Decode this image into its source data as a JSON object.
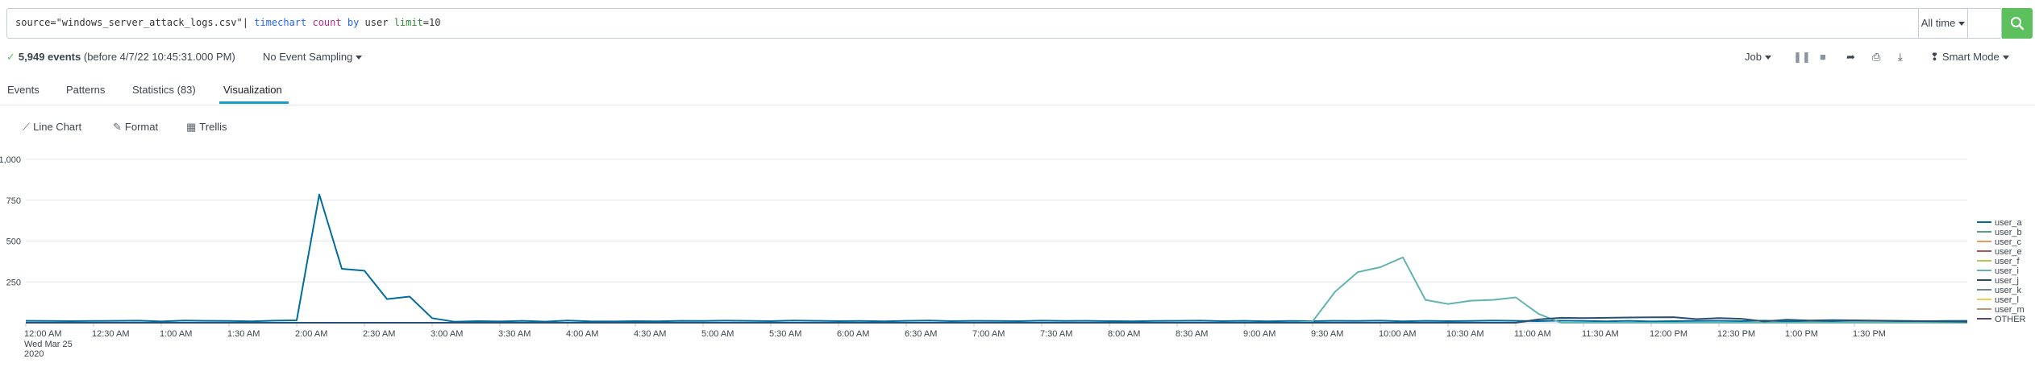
{
  "search": {
    "query_parts": [
      "source=\"windows_server_attack_logs.csv\"| ",
      "timechart",
      " ",
      "count",
      " ",
      "by",
      " user ",
      "limit",
      "=10"
    ],
    "time_range": "All time",
    "button": "search-icon"
  },
  "status": {
    "events": "5,949 events",
    "before": "(before 4/7/22 10:45:31.000 PM)",
    "sampling": "No Event Sampling",
    "job": "Job",
    "mode": "Smart Mode"
  },
  "tabs": [
    "Events",
    "Patterns",
    "Statistics (83)",
    "Visualization"
  ],
  "active_tab": 3,
  "viz_toolbar": [
    "Line Chart",
    "Format",
    "Trellis"
  ],
  "colors": {
    "accent": "#1a9cce",
    "search_button": "#5cc05c"
  },
  "chart_data": {
    "type": "line",
    "ylim": [
      0,
      1000
    ],
    "y_ticks": [
      "1,000",
      "750",
      "500",
      "250"
    ],
    "x_labels": [
      "12:00 AM",
      "12:30 AM",
      "1:00 AM",
      "1:30 AM",
      "2:00 AM",
      "2:30 AM",
      "3:00 AM",
      "3:30 AM",
      "4:00 AM",
      "4:30 AM",
      "5:00 AM",
      "5:30 AM",
      "6:00 AM",
      "6:30 AM",
      "7:00 AM",
      "7:30 AM",
      "8:00 AM",
      "8:30 AM",
      "9:00 AM",
      "9:30 AM",
      "10:00 AM",
      "10:30 AM",
      "11:00 AM",
      "11:30 AM",
      "12:00 PM",
      "12:30 PM",
      "1:00 PM",
      "1:30 PM"
    ],
    "x_sublabel": [
      "Wed Mar 25",
      "2020"
    ],
    "x_interval_minutes": 10,
    "series": [
      {
        "name": "user_a",
        "color": "#006d9c",
        "values": [
          12,
          11,
          10,
          11,
          12,
          13,
          8,
          14,
          12,
          11,
          9,
          13,
          15,
          785,
          330,
          318,
          145,
          160,
          28,
          6,
          10,
          8,
          12,
          7,
          14,
          9,
          8,
          10,
          9,
          12,
          11,
          13,
          12,
          10,
          14,
          12,
          10,
          11,
          9,
          12,
          14,
          10,
          12,
          11,
          10,
          13,
          11,
          12,
          10,
          9,
          11,
          12,
          13,
          10,
          12,
          9,
          11,
          10,
          12,
          11,
          13,
          9,
          12,
          10,
          11,
          14,
          12,
          10,
          13,
          11,
          9,
          12,
          8,
          10,
          11,
          12,
          10,
          13,
          9,
          11,
          10,
          12,
          11,
          10,
          9,
          11,
          12
        ]
      },
      {
        "name": "user_b",
        "color": "#4fa484",
        "values": []
      },
      {
        "name": "user_c",
        "color": "#ec9960",
        "values": []
      },
      {
        "name": "user_e",
        "color": "#af575a",
        "values": []
      },
      {
        "name": "user_f",
        "color": "#b6c75a",
        "values": []
      },
      {
        "name": "user_i",
        "color": "#62b3b2",
        "values": [
          0,
          0,
          0,
          0,
          0,
          0,
          0,
          0,
          0,
          0,
          0,
          0,
          0,
          0,
          0,
          0,
          0,
          0,
          0,
          0,
          0,
          0,
          0,
          0,
          0,
          0,
          0,
          0,
          0,
          0,
          0,
          0,
          0,
          0,
          0,
          0,
          0,
          0,
          0,
          0,
          0,
          0,
          0,
          0,
          0,
          0,
          0,
          0,
          0,
          0,
          0,
          0,
          0,
          0,
          0,
          0,
          0,
          8,
          190,
          310,
          340,
          400,
          140,
          115,
          135,
          140,
          155,
          55,
          0,
          0,
          0,
          0,
          0,
          0,
          0,
          0,
          0,
          0,
          0,
          0,
          0,
          0,
          0,
          0,
          0,
          0,
          0
        ]
      },
      {
        "name": "user_j",
        "color": "#294e70",
        "values": [
          0,
          0,
          0,
          0,
          0,
          0,
          0,
          0,
          0,
          0,
          0,
          0,
          0,
          0,
          0,
          0,
          0,
          0,
          0,
          0,
          0,
          0,
          0,
          0,
          0,
          0,
          0,
          0,
          0,
          0,
          0,
          0,
          0,
          0,
          0,
          0,
          0,
          0,
          0,
          0,
          0,
          0,
          0,
          0,
          0,
          0,
          0,
          0,
          0,
          0,
          0,
          0,
          0,
          0,
          0,
          0,
          0,
          0,
          0,
          0,
          0,
          0,
          0,
          0,
          0,
          0,
          0,
          20,
          30,
          28,
          30,
          32,
          33,
          34,
          22,
          28,
          24,
          8,
          18,
          14,
          16,
          15,
          13,
          12,
          10,
          8,
          6
        ]
      },
      {
        "name": "user_k",
        "color": "#738795",
        "values": []
      },
      {
        "name": "user_l",
        "color": "#edd051",
        "values": []
      },
      {
        "name": "user_m",
        "color": "#bd9872",
        "values": []
      },
      {
        "name": "OTHER",
        "color": "#5a4575",
        "values": []
      }
    ]
  }
}
